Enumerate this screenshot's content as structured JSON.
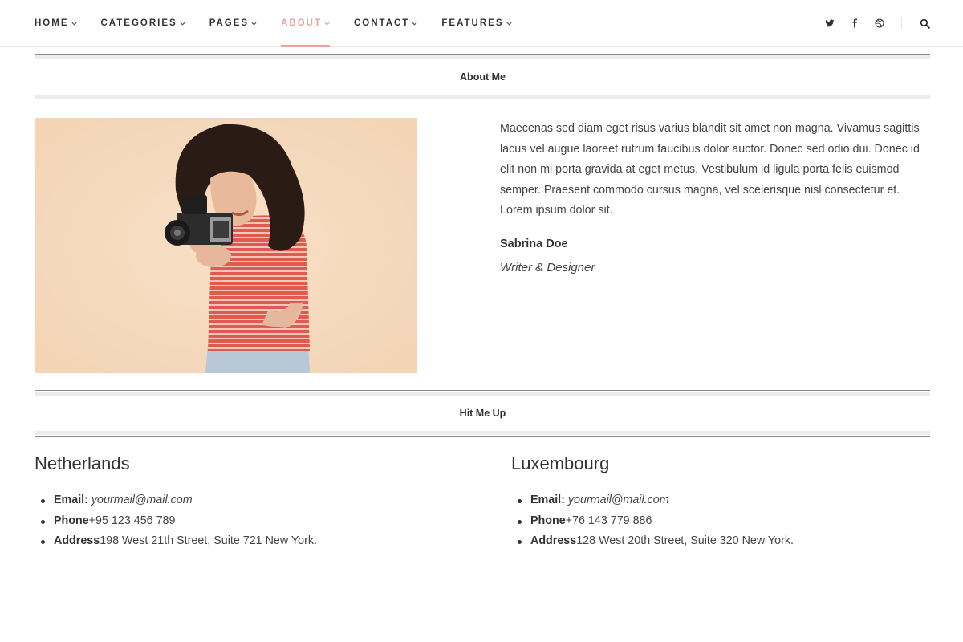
{
  "nav": {
    "items": [
      {
        "label": "HOME"
      },
      {
        "label": "CATEGORIES"
      },
      {
        "label": "PAGES"
      },
      {
        "label": "ABOUT"
      },
      {
        "label": "CONTACT"
      },
      {
        "label": "FEATURES"
      }
    ],
    "active_index": 3,
    "accent_color": "#e8a39a"
  },
  "header_icons": [
    "twitter-icon",
    "facebook-icon",
    "dribbble-icon",
    "search-icon"
  ],
  "about": {
    "section_title": "About Me",
    "bio": "Maecenas sed diam eget risus varius blandit sit amet non magna. Vivamus sagittis lacus vel augue laoreet rutrum faucibus dolor auctor. Donec sed odio dui. Donec id elit non mi porta gravida at eget metus. Vestibulum id ligula porta felis euismod semper. Praesent commodo cursus magna, vel scelerisque nisl consectetur et. Lorem ipsum dolor sit.",
    "name": "Sabrina Doe",
    "role": "Writer & Designer"
  },
  "contact": {
    "section_title": "Hit Me Up",
    "offices": [
      {
        "city": "Netherlands",
        "email_label": "Email:",
        "email": "yourmail@mail.com",
        "phone_label": "Phone",
        "phone": "+95 123 456 789",
        "address_label": "Address",
        "address": "198 West 21th Street, Suite 721 New York."
      },
      {
        "city": "Luxembourg",
        "email_label": "Email:",
        "email": "yourmail@mail.com",
        "phone_label": "Phone",
        "phone": "+76 143 779 886",
        "address_label": "Address",
        "address": "128 West 20th Street, Suite 320 New York."
      }
    ]
  }
}
